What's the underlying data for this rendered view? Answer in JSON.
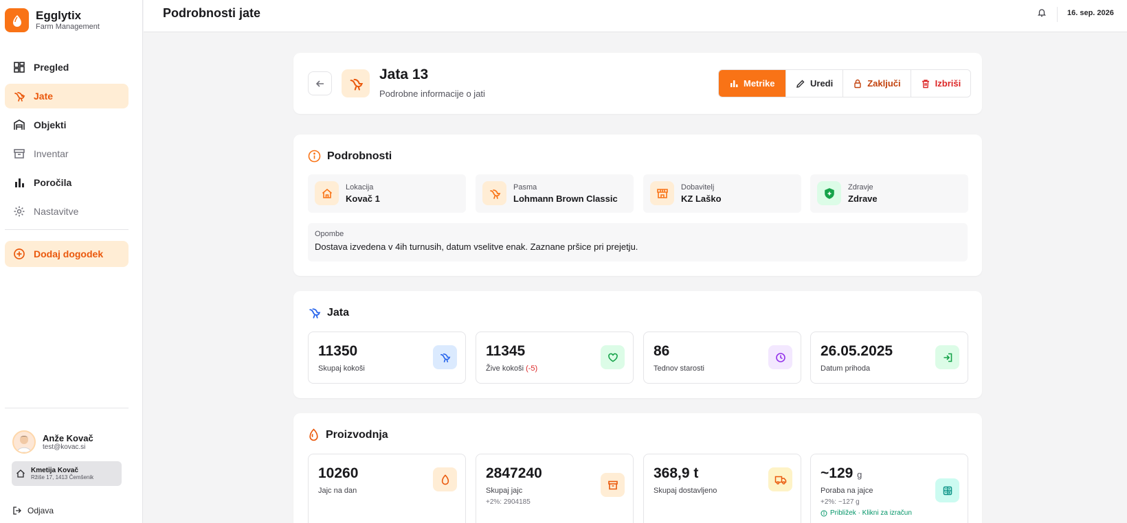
{
  "brand": {
    "name": "Egglytix",
    "subtitle": "Farm Management"
  },
  "nav": {
    "items": [
      {
        "label": "Pregled",
        "icon": "dashboard-icon"
      },
      {
        "label": "Jate",
        "icon": "bird-icon",
        "active": true
      },
      {
        "label": "Objekti",
        "icon": "warehouse-icon"
      },
      {
        "label": "Inventar",
        "icon": "archive-icon"
      },
      {
        "label": "Poročila",
        "icon": "bar-chart-icon"
      },
      {
        "label": "Nastavitve",
        "icon": "gear-icon"
      }
    ],
    "add_event": "Dodaj dogodek"
  },
  "user": {
    "name": "Anže Kovač",
    "email": "test@kovac.si"
  },
  "farm": {
    "name": "Kmetija Kovač",
    "address": "Ržiše 17, 1413 Čemšenik"
  },
  "logout": "Odjava",
  "topbar": {
    "title": "Podrobnosti jate",
    "date": "16. sep. 2026"
  },
  "header": {
    "title": "Jata 13",
    "subtitle": "Podrobne informacije o jati",
    "actions": {
      "metrics": "Metrike",
      "edit": "Uredi",
      "close": "Zaključi",
      "delete": "Izbriši"
    }
  },
  "details": {
    "title": "Podrobnosti",
    "tiles": [
      {
        "label": "Lokacija",
        "value": "Kovač 1"
      },
      {
        "label": "Pasma",
        "value": "Lohmann Brown Classic"
      },
      {
        "label": "Dobavitelj",
        "value": "KZ Laško"
      },
      {
        "label": "Zdravje",
        "value": "Zdrave"
      }
    ],
    "notes_label": "Opombe",
    "notes_text": "Dostava izvedena v 4ih turnusih, datum vselitve enak. Zaznane pršice pri prejetju."
  },
  "flock": {
    "title": "Jata",
    "stats": [
      {
        "value": "11350",
        "label": "Skupaj kokoši"
      },
      {
        "value": "11345",
        "label": "Žive kokoši",
        "delta": "(-5)"
      },
      {
        "value": "86",
        "label": "Tednov starosti"
      },
      {
        "value": "26.05.2025",
        "label": "Datum prihoda"
      }
    ]
  },
  "production": {
    "title": "Proizvodnja",
    "stats": [
      {
        "value": "10260",
        "label": "Jajc na dan"
      },
      {
        "value": "2847240",
        "label": "Skupaj jajc",
        "extra": "+2%: 2904185"
      },
      {
        "value": "368,9 t",
        "label": "Skupaj dostavljeno"
      },
      {
        "value": "~129",
        "unit": "g",
        "label": "Poraba na jajce",
        "extra": "+2%: ~127 g",
        "link": "Približek · Klikni za izračun"
      }
    ]
  },
  "colors": {
    "accent": "#f97316",
    "accent_soft": "#ffedd5",
    "danger": "#dc2626",
    "success": "#059669"
  }
}
